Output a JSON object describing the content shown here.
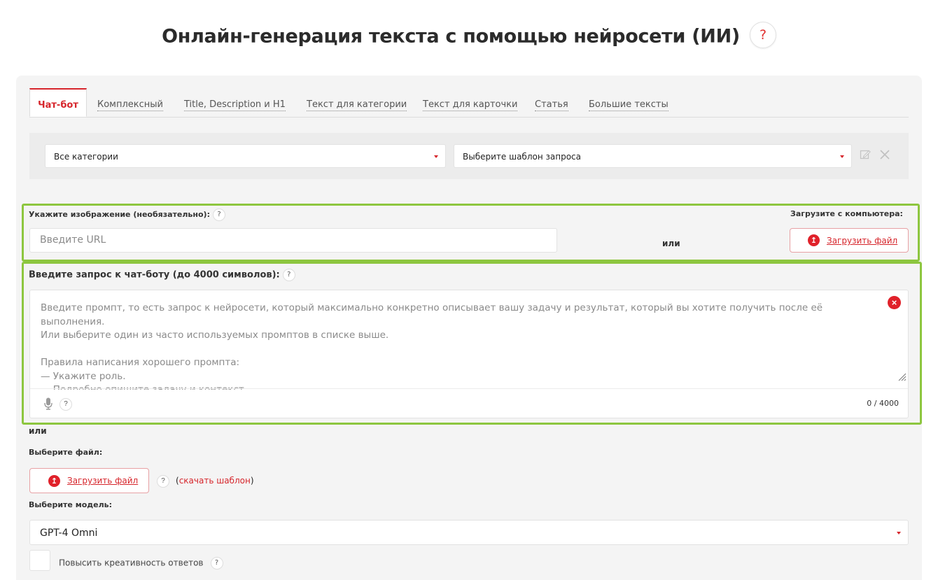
{
  "header": {
    "title": "Онлайн-генерация текста с помощью нейросети (ИИ)",
    "help": "?"
  },
  "tabs": [
    {
      "label": "Чат-бот",
      "active": true
    },
    {
      "label": "Комплексный"
    },
    {
      "label": "Title, Description и H1"
    },
    {
      "label": "Текст для категории"
    },
    {
      "label": "Текст для карточки"
    },
    {
      "label": "Статья"
    },
    {
      "label": "Большие тексты"
    }
  ],
  "filters": {
    "category": "Все категории",
    "template": "Выберите шаблон запроса",
    "edit_icon": "edit-icon",
    "close_icon": "close-icon"
  },
  "image": {
    "label": "Укажите изображение (необязательно):",
    "help": "?",
    "url_placeholder": "Введите URL",
    "or": "или",
    "upload_label": "Загрузите с компьютера:",
    "upload_button": "Загрузить файл"
  },
  "prompt": {
    "label": "Введите запрос к чат-боту (до 4000 символов):",
    "help": "?",
    "placeholder": "Введите промпт, то есть запрос к нейросети, который максимально конкретно описывает вашу задачу и результат, который вы хотите получить после её выполнения.\nИли выберите один из часто используемых промптов в списке выше.\n\nПравила написания хорошего промпта:\n— Укажите роль.\n— Подробно опишите задачу и контекст.\n— Обозначьте стиль.",
    "mic_help": "?",
    "counter": "0 / 4000"
  },
  "file": {
    "or": "или",
    "label": "Выберите файл:",
    "upload_button": "Загрузить файл",
    "help": "?",
    "template_link_open": "(",
    "template_link": "скачать шаблон",
    "template_link_close": ")"
  },
  "model": {
    "label": "Выберите модель:",
    "value": "GPT-4 Omni"
  },
  "creativity": {
    "label": "Повысить креативность ответов",
    "help": "?",
    "checked": false
  },
  "colors": {
    "accent": "#d6252b",
    "highlight": "#8dc63f",
    "panel": "#f4f4f4"
  }
}
